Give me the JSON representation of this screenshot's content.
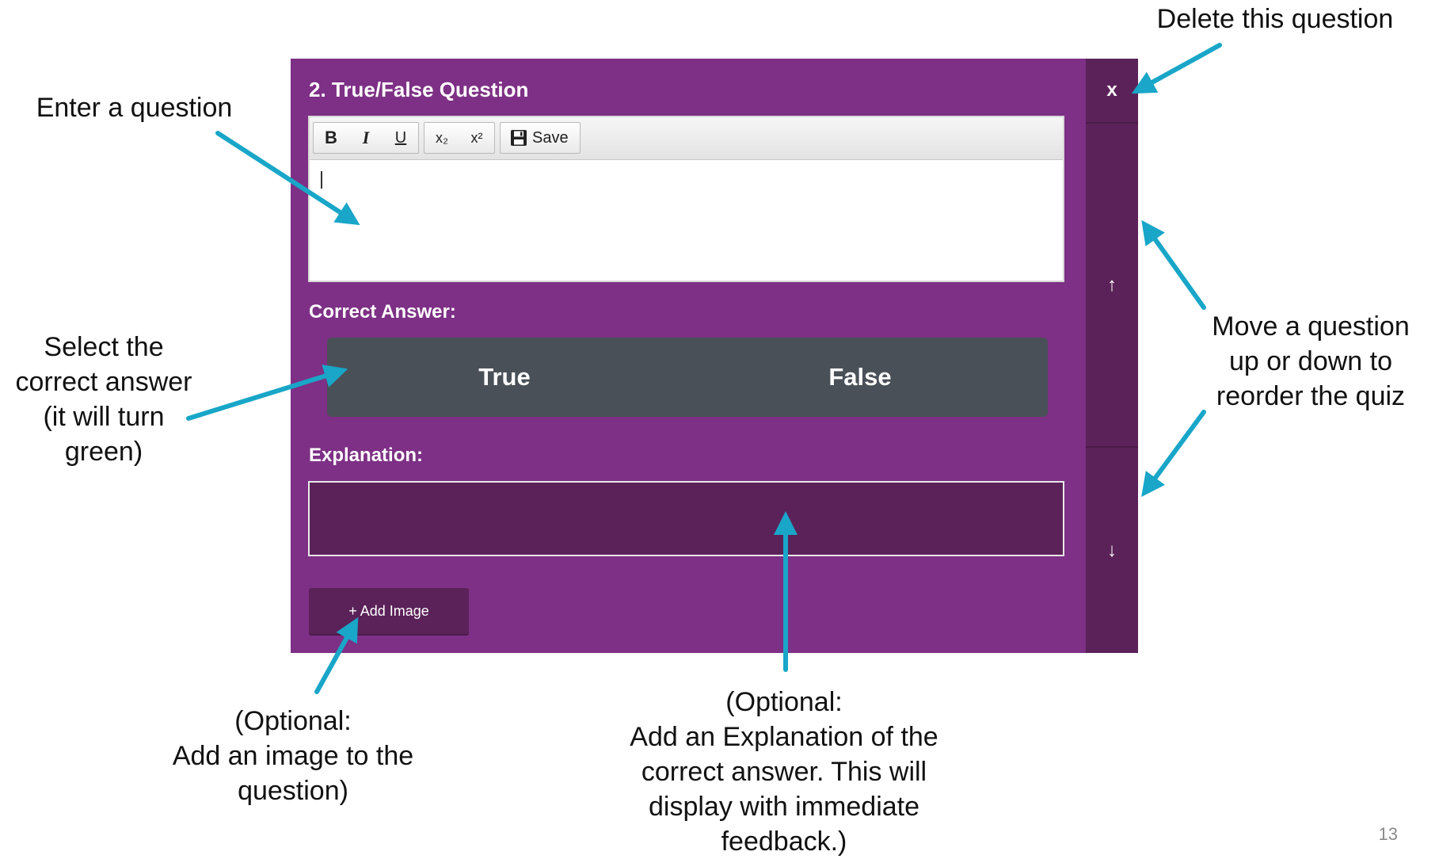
{
  "callouts": {
    "delete": "Delete this question",
    "enter_question": "Enter a question",
    "select_correct": [
      "Select the",
      "correct answer",
      "(it will turn",
      "green)"
    ],
    "move": [
      "Move a question",
      "up or down to",
      "reorder the quiz"
    ],
    "add_image": [
      "(Optional:",
      "Add an image to the",
      "question)"
    ],
    "explanation": [
      "(Optional:",
      "Add an Explanation of the",
      "correct answer. This will",
      "display with immediate",
      "feedback.)"
    ]
  },
  "question": {
    "title": "2. True/False Question",
    "editor_value": "",
    "toolbar": {
      "bold": "B",
      "italic": "I",
      "underline": "U",
      "subscript": "x₂",
      "superscript": "x²",
      "save_label": "Save"
    },
    "correct_answer_label": "Correct Answer:",
    "options": [
      "True",
      "False"
    ],
    "explanation_label": "Explanation:",
    "explanation_value": "",
    "add_image_label": "+ Add Image"
  },
  "side_controls": {
    "delete_label": "x",
    "up_label": "↑",
    "down_label": "↓"
  },
  "page_number": "13",
  "colors": {
    "panel": "#7d3085",
    "panel_dark": "#5b2259",
    "answer_bg": "#4a5058",
    "arrow": "#19a6c8"
  }
}
